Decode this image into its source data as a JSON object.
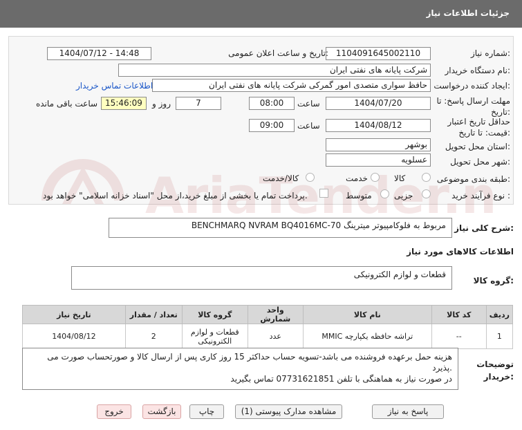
{
  "header": {
    "title": "جزئیات اطلاعات نیاز"
  },
  "form": {
    "need_number_label": "شماره نیاز:",
    "need_number": "1104091645002110",
    "announce_label": "تاریخ و ساعت اعلان عمومی:",
    "announce_value": "1404/07/12 - 14:48",
    "buyer_org_label": "نام دستگاه خریدار:",
    "buyer_org": "شرکت پایانه های نفتی ایران",
    "creator_label": "ایجاد کننده درخواست:",
    "creator": "حافظ سواری متصدی امور گمرکی شرکت پایانه های نفتی ایران",
    "contact_link": "اطلاعات تماس خریدار",
    "deadline_label_1": "مهلت ارسال پاسخ: تا",
    "deadline_label_2": "تاریخ:",
    "deadline_date": "1404/07/20",
    "time_label": "ساعت",
    "deadline_time": "08:00",
    "days_value": "7",
    "days_label": "روز و",
    "remaining_time": "15:46:09",
    "remaining_label": "ساعت باقی مانده",
    "validity_label_1": "حداقل تاریخ اعتبار",
    "validity_label_2": "قیمت: تا تاریخ:",
    "validity_date": "1404/08/12",
    "validity_time": "09:00",
    "province_label": "استان محل تحویل:",
    "province": "بوشهر",
    "city_label": "شهر محل تحویل:",
    "city": "عسلویه",
    "category_label": "طبقه بندی موضوعی:",
    "category_options": [
      "کالا",
      "خدمت",
      "کالا/خدمت"
    ],
    "process_label": "نوع فرآیند خرید :",
    "process_options": [
      "جزیی",
      "متوسط"
    ],
    "payment_note": "پرداخت تمام یا بخشی از مبلغ خرید،از محل \"اسناد خزانه اسلامی\" خواهد بود."
  },
  "summary": {
    "label": "شرح کلی نیاز:",
    "value": "BENCHMARQ NVRAM BQ4016MC-70  مربوط به فلوکامپیوتر میترینگ"
  },
  "goods": {
    "section_title": "اطلاعات کالاهای مورد نیاز",
    "group_label": "گروه کالا:",
    "group_value": "قطعات و لوازم الکترونیکی"
  },
  "table": {
    "headers": [
      "ردیف",
      "کد کالا",
      "نام کالا",
      "واحد شمارش",
      "گروه کالا",
      "تعداد / مقدار",
      "تاریخ نیاز"
    ],
    "rows": [
      {
        "row": "1",
        "code": "--",
        "name": "تراشه حافظه یکپارچه MMIC",
        "unit": "عدد",
        "group": "قطعات و لوازم الکترونیکی",
        "qty": "2",
        "date": "1404/08/12"
      }
    ]
  },
  "buyer_notes": {
    "label_1": "توضیحات",
    "label_2": "خریدار:",
    "line_1": "هزینه حمل برعهده فروشنده می باشد-تسویه حساب حداکثر 15 روز کاری پس از ارسال کالا و صورتحساب صورت می پذیرد.",
    "line_2": "در صورت نیاز به هماهنگی با تلفن 07731621851 تماس بگیرید"
  },
  "buttons": {
    "reply": "پاسخ به نیاز",
    "attachments": "مشاهده مدارک پیوستی (1)",
    "print": "چاپ",
    "back": "بازگشت",
    "exit": "خروج"
  },
  "watermark": {
    "text": "AriaTender.net"
  },
  "colors": {
    "header_bg": "#6b6b6b",
    "link": "#1a56c8",
    "yellow_field": "#ffffc0"
  }
}
